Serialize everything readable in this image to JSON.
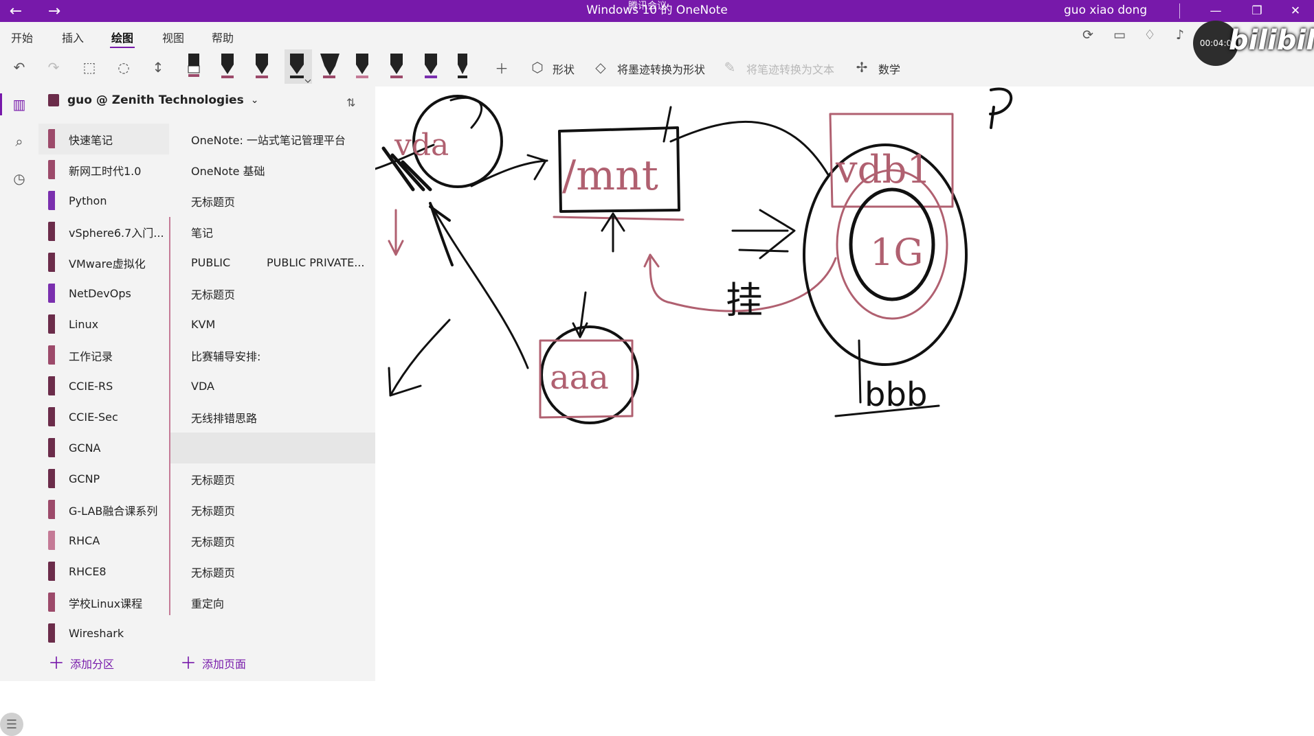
{
  "titlebar": {
    "back_icon": "back-arrow-icon",
    "forward_icon": "forward-arrow-icon",
    "title": "Windows 10 的 OneNote",
    "overlay_text": "腾讯会议",
    "user": "guo xiao dong",
    "accent": "#7719aa"
  },
  "menu": {
    "tabs": [
      "开始",
      "插入",
      "绘图",
      "视图",
      "帮助"
    ],
    "active_tab": "绘图"
  },
  "toolbar": {
    "shape_label": "形状",
    "ink_to_shape_label": "将墨迹转换为形状",
    "ink_to_text_label": "将笔迹转换为文本",
    "math_label": "数学"
  },
  "notebook": {
    "name": "guo @ Zenith Technologies",
    "sections": [
      {
        "label": "快速笔记",
        "color": "#9c4a6a"
      },
      {
        "label": "新网工时代1.0",
        "color": "#9c4a6a"
      },
      {
        "label": "Python",
        "color": "#7a2fae"
      },
      {
        "label": "vSphere6.7入门...",
        "color": "#6b2c4a"
      },
      {
        "label": "VMware虚拟化",
        "color": "#6b2c4a"
      },
      {
        "label": "NetDevOps",
        "color": "#7a2fae"
      },
      {
        "label": "Linux",
        "color": "#6b2c4a"
      },
      {
        "label": "工作记录",
        "color": "#9c4a6a"
      },
      {
        "label": "CCIE-RS",
        "color": "#6b2c4a"
      },
      {
        "label": "CCIE-Sec",
        "color": "#6b2c4a"
      },
      {
        "label": "GCNA",
        "color": "#6b2c4a"
      },
      {
        "label": "GCNP",
        "color": "#6b2c4a"
      },
      {
        "label": "G-LAB融合课系列",
        "color": "#9c4a6a"
      },
      {
        "label": "RHCA",
        "color": "#c47a96"
      },
      {
        "label": "RHCE8",
        "color": "#6b2c4a"
      },
      {
        "label": "学校Linux课程",
        "color": "#9c4a6a"
      },
      {
        "label": "Wireshark",
        "color": "#6b2c4a"
      }
    ],
    "pages": [
      {
        "label": "OneNote: 一站式笔记管理平台"
      },
      {
        "label": "OneNote 基础"
      },
      {
        "label": "无标题页"
      },
      {
        "label": "笔记"
      },
      {
        "label": "PUBLIC",
        "sub": "PUBLIC PRIVATE..."
      },
      {
        "label": "无标题页"
      },
      {
        "label": "KVM"
      },
      {
        "label": "比赛辅导安排:"
      },
      {
        "label": "VDA"
      },
      {
        "label": "无线排错思路"
      },
      {
        "label": ""
      },
      {
        "label": "无标题页"
      },
      {
        "label": "无标题页"
      },
      {
        "label": "无标题页"
      },
      {
        "label": "无标题页"
      },
      {
        "label": "重定向"
      }
    ],
    "add_section": "添加分区",
    "add_page": "添加页面"
  },
  "overlay": {
    "timer": "00:04:0",
    "brand": "bilibili"
  },
  "ink": {
    "vda": "vda",
    "mnt": "/mnt",
    "vdb": "vdb1",
    "onegig": "1G",
    "aaa": "aaa",
    "bbb": "bbb",
    "hang": "挂"
  }
}
